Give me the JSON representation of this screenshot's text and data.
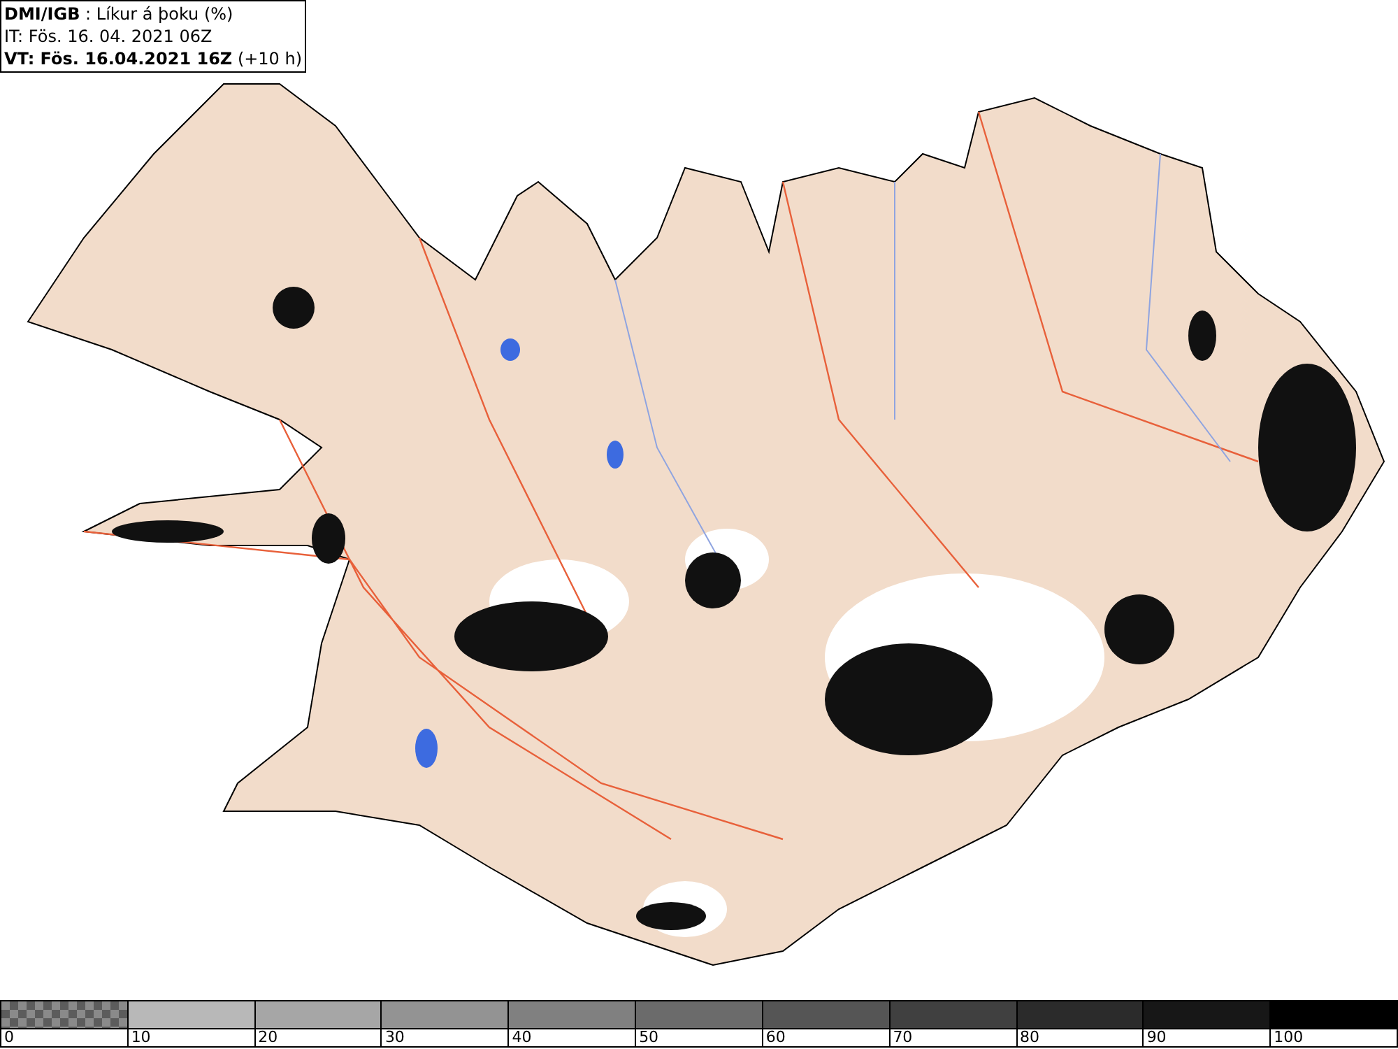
{
  "header": {
    "lines": [
      "**DMI/IGB** : Líkur á þoku (%)",
      "IT: Fös. 16. 04. 2021 06Z",
      "**VT: Fös. 16.04.2021 16Z** (+10 h)"
    ]
  },
  "legend": {
    "items": [
      {
        "label": "0",
        "kind": "checker",
        "color": "#8a8a8a"
      },
      {
        "label": "10",
        "kind": "solid",
        "color": "#b8b8b8"
      },
      {
        "label": "20",
        "kind": "solid",
        "color": "#a6a6a6"
      },
      {
        "label": "30",
        "kind": "solid",
        "color": "#939393"
      },
      {
        "label": "40",
        "kind": "solid",
        "color": "#808080"
      },
      {
        "label": "50",
        "kind": "solid",
        "color": "#6b6b6b"
      },
      {
        "label": "60",
        "kind": "solid",
        "color": "#555555"
      },
      {
        "label": "70",
        "kind": "solid",
        "color": "#404040"
      },
      {
        "label": "80",
        "kind": "solid",
        "color": "#2b2b2b"
      },
      {
        "label": "90",
        "kind": "solid",
        "color": "#171717"
      },
      {
        "label": "100",
        "kind": "solid",
        "color": "#000000"
      }
    ]
  }
}
